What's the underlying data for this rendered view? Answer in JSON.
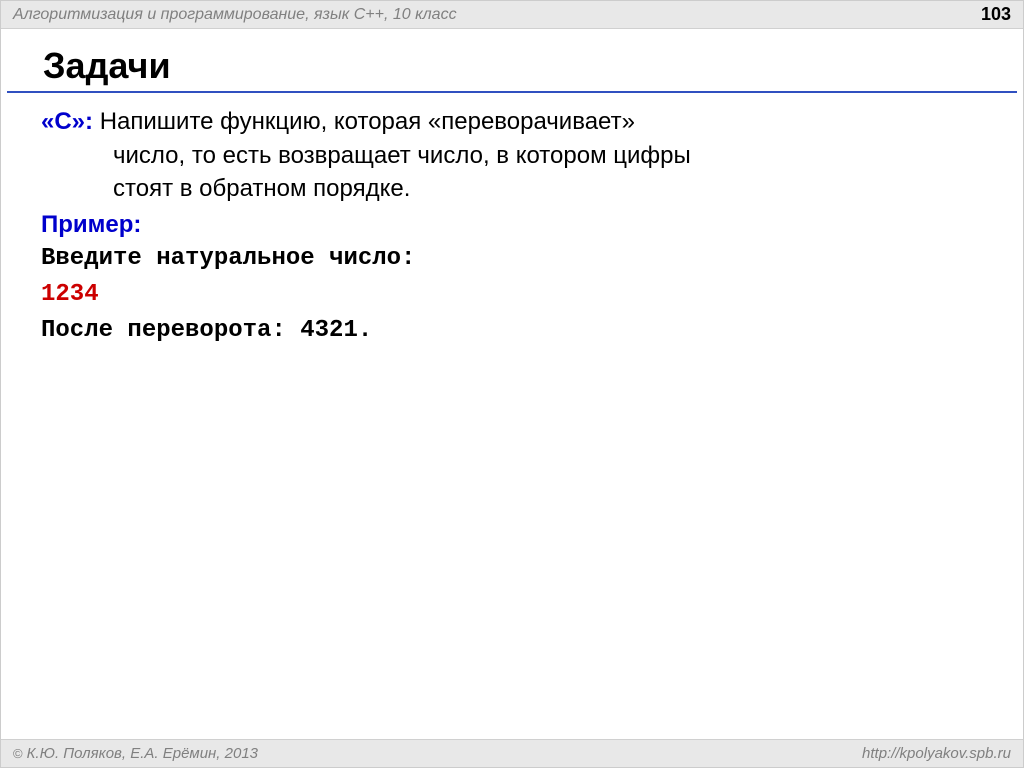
{
  "header": {
    "title": "Алгоритмизация и программирование, язык  C++, 10 класс",
    "page_number": "103"
  },
  "main_title": "Задачи",
  "task": {
    "label": "«C»:",
    "line1": " Напишите функцию, которая «переворачивает»",
    "line2": "число, то есть возвращает число, в котором цифры",
    "line3": "стоят в обратном порядке."
  },
  "example": {
    "label": "Пример:",
    "prompt": "Введите натуральное число:",
    "input": "1234",
    "output": "После переворота: 4321."
  },
  "footer": {
    "copyright_symbol": "©",
    "authors": " К.Ю. Поляков, Е.А. Ерёмин, 2013",
    "url": "http://kpolyakov.spb.ru"
  }
}
